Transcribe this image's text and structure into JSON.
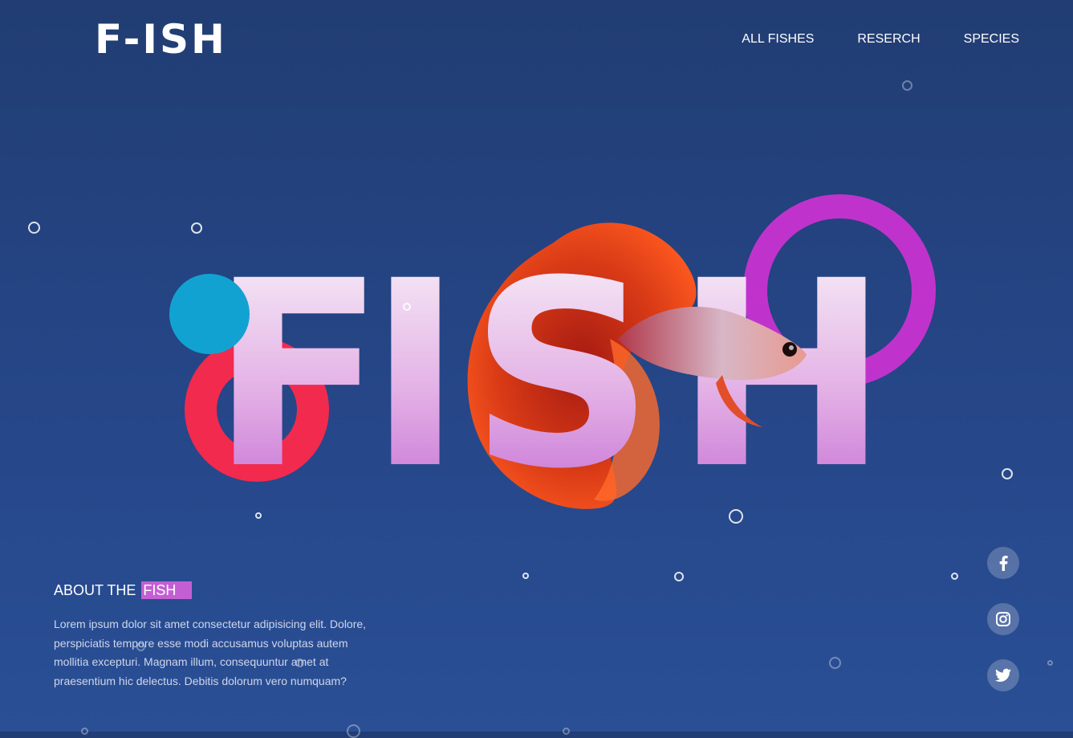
{
  "header": {
    "logo": "F-ISH",
    "nav": [
      "ALL FISHES",
      "RESERCH",
      "SPECIES"
    ]
  },
  "hero": {
    "word": [
      "F",
      "I",
      "S",
      "H"
    ]
  },
  "about": {
    "title": "ABOUT THE",
    "highlight": "FISH",
    "text": "Lorem ipsum dolor sit amet consectetur adipisicing elit. Dolore, perspiciatis tempore esse modi accusamus voluptas autem mollitia excepturi. Magnam illum, consequuntur amet at praesentium hic delectus. Debitis dolorum vero numquam?"
  },
  "social": {
    "icons": [
      "facebook-icon",
      "instagram-icon",
      "twitter-icon"
    ]
  },
  "colors": {
    "background": "#213d73",
    "accent_blue": "#12a2d2",
    "accent_red": "#f22a4e",
    "accent_purple": "#bf33cc",
    "highlight": "#c45fd3"
  }
}
